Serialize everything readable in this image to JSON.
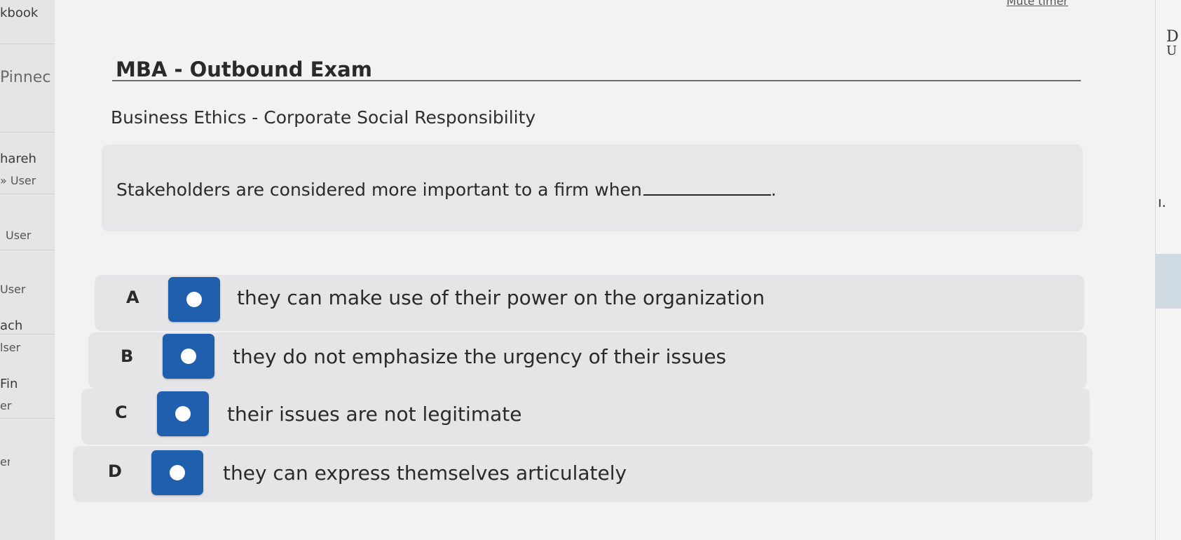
{
  "left_panel": {
    "items": [
      "kbook",
      "Pinnec",
      "hareh",
      "» User",
      "User",
      "User",
      "ach",
      "lser",
      "Fin",
      "er",
      "er"
    ]
  },
  "top_bar": {
    "mute_timer_label": "Mute timer"
  },
  "right_edge": {
    "glyphs": [
      "D",
      "U",
      "ı."
    ]
  },
  "exam": {
    "title": "MBA - Outbound Exam",
    "section": "Business Ethics - Corporate Social Responsibility",
    "question": "Stakeholders are considered more important to a firm when",
    "question_end": ".",
    "options": [
      {
        "letter": "A",
        "text": "they can make use of their power on the organization"
      },
      {
        "letter": "B",
        "text": "they do not emphasize the urgency of their issues"
      },
      {
        "letter": "C",
        "text": "their issues are not legitimate"
      },
      {
        "letter": "D",
        "text": "they can express themselves articulately"
      }
    ]
  },
  "colors": {
    "answer_button": "#1f5fae",
    "background": "#f2f2f3",
    "answer_row": "#e5e5e7"
  }
}
